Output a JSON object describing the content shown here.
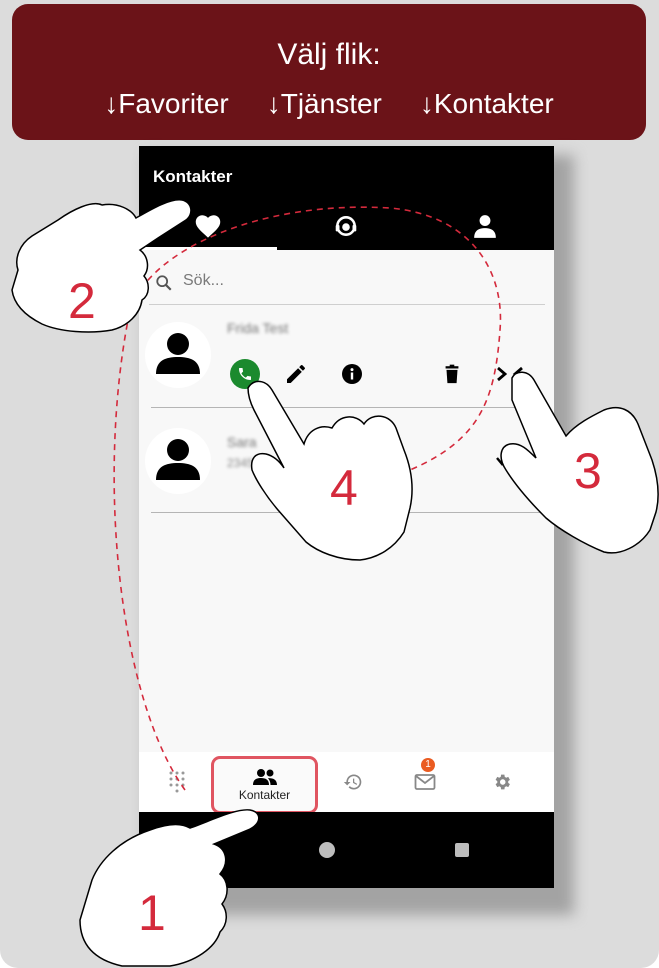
{
  "banner": {
    "title": "Välj flik:",
    "tabs": [
      "↓Favoriter",
      "↓Tjänster",
      "↓Kontakter"
    ],
    "color": "#6b1318"
  },
  "app": {
    "title": "Kontakter",
    "tabs": [
      {
        "icon": "heart-icon",
        "active": true
      },
      {
        "icon": "headset-icon",
        "active": false
      },
      {
        "icon": "person-icon",
        "active": false
      }
    ]
  },
  "search": {
    "placeholder": "Sök..."
  },
  "contacts": [
    {
      "name": "Frida Test",
      "number": "",
      "expanded": true,
      "actions": [
        "phone-icon",
        "pencil-icon",
        "info-icon",
        "trash-icon",
        "collapse-icon"
      ]
    },
    {
      "name": "Sara",
      "number": "23456",
      "expanded": false
    }
  ],
  "bottom_nav": {
    "items": [
      {
        "icon": "dialpad-icon",
        "label": ""
      },
      {
        "icon": "contacts-icon",
        "label": "Kontakter",
        "active": true
      },
      {
        "icon": "history-icon",
        "label": ""
      },
      {
        "icon": "mail-icon",
        "label": "",
        "badge": "1"
      },
      {
        "icon": "gear-icon",
        "label": ""
      }
    ]
  },
  "steps": [
    "1",
    "2",
    "3",
    "4"
  ],
  "colors": {
    "accent": "#d42a3c",
    "call": "#1b8a2e",
    "badge": "#ea5b21"
  }
}
